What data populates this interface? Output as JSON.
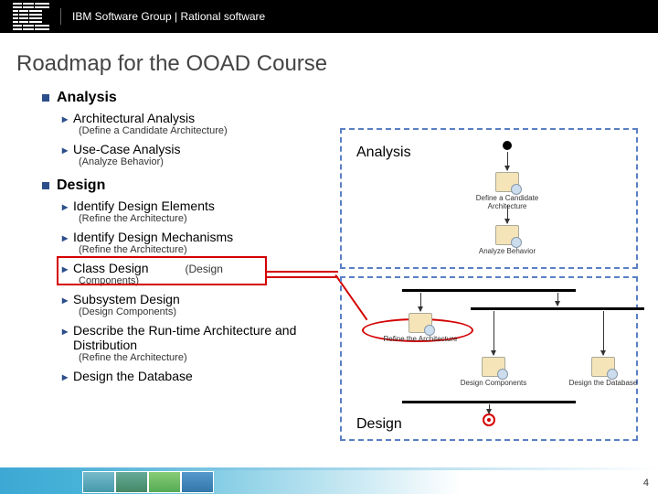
{
  "header": {
    "brand": "IBM",
    "text": "IBM Software Group | Rational software"
  },
  "title": "Roadmap for the OOAD Course",
  "sections": {
    "analysis": {
      "label": "Analysis",
      "items": [
        {
          "label": "Architectural Analysis",
          "paren": "(Define a Candidate Architecture)"
        },
        {
          "label": "Use-Case Analysis",
          "paren": "(Analyze Behavior)"
        }
      ]
    },
    "design": {
      "label": "Design",
      "items": [
        {
          "label": "Identify Design Elements",
          "paren": "(Refine the Architecture)"
        },
        {
          "label": "Identify Design Mechanisms",
          "paren": "(Refine the Architecture)"
        },
        {
          "label": "Class Design",
          "inline_paren": "(Design",
          "paren": "Components)"
        },
        {
          "label": "Subsystem Design",
          "paren": "(Design Components)"
        },
        {
          "label": "Describe the Run-time Architecture and Distribution",
          "paren": "(Refine the Architecture)"
        },
        {
          "label": "Design the Database",
          "paren": ""
        }
      ]
    }
  },
  "diagram": {
    "analysis_label": "Analysis",
    "design_label": "Design",
    "nodes": {
      "a1": "Define a Candidate Architecture",
      "a2": "Analyze Behavior",
      "d1": "Refine the Architecture",
      "d2": "Design Components",
      "d3": "Design the Database"
    }
  },
  "footer": {
    "page": "4"
  }
}
